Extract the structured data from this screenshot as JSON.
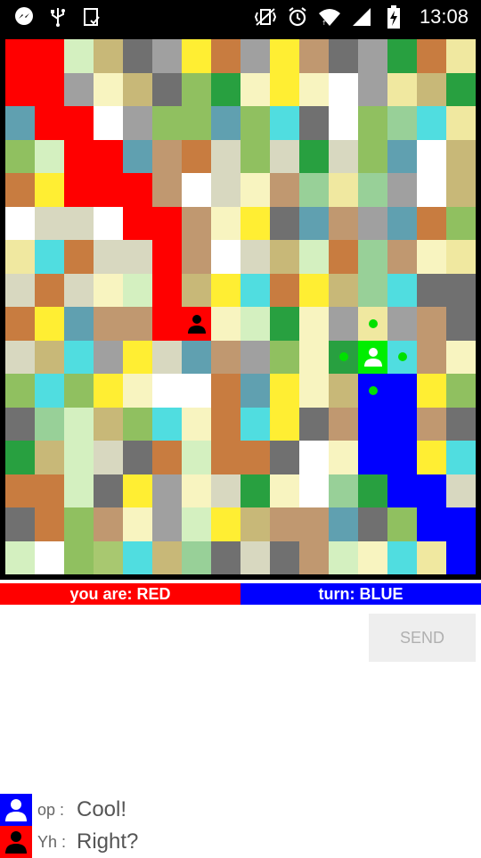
{
  "status_bar": {
    "time": "13:08",
    "left_icons": [
      "messenger-icon",
      "usb-icon",
      "clipboard-check-icon"
    ],
    "right_icons": [
      "vibrate-icon",
      "alarm-icon",
      "wifi-icon",
      "signal-icon",
      "battery-charging-icon"
    ]
  },
  "board": {
    "rows": 16,
    "cols": 16,
    "palette": {
      "R": "#ff0000",
      "B": "#0000ff",
      "W": "#ffffff",
      "a": "#d4f0c0",
      "b": "#c8b878",
      "c": "#707070",
      "d": "#a0a0a0",
      "y": "#ffee33",
      "o": "#c87c40",
      "t": "#c09870",
      "l": "#f8f4c0",
      "g": "#28a040",
      "s": "#a8c870",
      "k": "#60a0b0",
      "m": "#90c060",
      "n": "#50dde0",
      "e": "#d8d8c0",
      "f": "#98d098",
      "h": "#f0e8a0",
      "G": "#28a040",
      "L": "#00ee00"
    },
    "grid": [
      "RRabcdyodytcdgoh",
      "RRdlbcmglylWdhbg",
      "kRRWdmmkmncWmfnh",
      "maRRktoemegemkWb",
      "oyRRRtWeltfhfdWb",
      "WeeWRRtlycktdkom",
      "hnoeeRtWebaoftlh",
      "eoelaRbynoybfncc",
      "oykttRRlagldhdtc",
      "ebndyektdmlGLntl",
      "mnmylWWokylbBBym",
      "cfabmnlonyctBBtc",
      "gbaecoaoocWlBByn",
      "ooacydleglWfgBBe",
      "comtldaybttkcmBB",
      "aWmsnbfcectalnhB"
    ],
    "red_player": {
      "row": 8,
      "col": 6,
      "color": "#000000"
    },
    "blue_player": {
      "row": 9,
      "col": 12,
      "color": "#ffffff"
    },
    "move_hints": [
      {
        "row": 8,
        "col": 12
      },
      {
        "row": 9,
        "col": 11
      },
      {
        "row": 9,
        "col": 13
      },
      {
        "row": 10,
        "col": 12
      }
    ]
  },
  "info": {
    "you_are": "you are: RED",
    "turn": "turn: BLUE"
  },
  "send_label": "SEND",
  "chat": [
    {
      "name": "op :",
      "message": "Cool!",
      "color": "#0000ff"
    },
    {
      "name": "Yh :",
      "message": "Right?",
      "color": "#ff0000"
    }
  ]
}
